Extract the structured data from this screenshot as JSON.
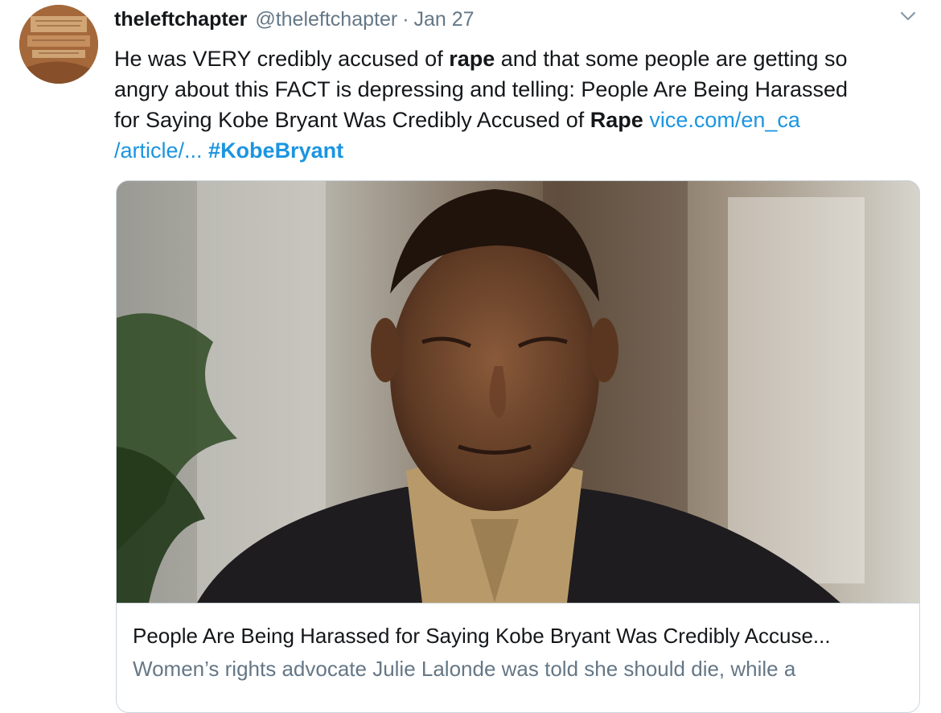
{
  "tweet": {
    "display_name": "theleftchapter",
    "handle": "@theleftchapter",
    "separator": "·",
    "date": "Jan 27",
    "text": {
      "line1_a": "He was VERY credibly accused of ",
      "line1_b": "rape",
      "line1_c": " and that some people are getting so",
      "line2": "angry about this FACT is depressing and telling: People Are Being Harassed",
      "line3_a": "for Saying Kobe Bryant Was Credibly Accused of ",
      "line3_b": "Rape",
      "line3_link": "vice.com/en_ca",
      "line4_link": "/article/...",
      "line4_hashtag": "#KobeBryant"
    },
    "icons": {
      "menu": "chevron-down-icon",
      "avatar": "profile-avatar"
    }
  },
  "card": {
    "title": "People Are Being Harassed for Saying Kobe Bryant Was Credibly Accuse...",
    "description": "Women’s rights advocate Julie Lalonde was told she should die, while a"
  },
  "colors": {
    "link": "#1b95e0",
    "text": "#14171a",
    "secondary": "#657786",
    "border": "#ccd6dd"
  }
}
